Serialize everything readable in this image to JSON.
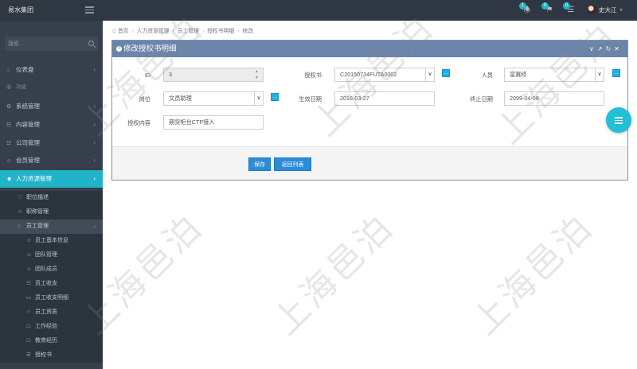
{
  "app": {
    "brand": "易水集团"
  },
  "topbar": {
    "badges": [
      "1",
      "0",
      "0"
    ],
    "user_name": "史大江"
  },
  "sidebar": {
    "search_placeholder": "搜索...",
    "items": [
      {
        "label": "仪表盘"
      },
      {
        "label": "功能"
      },
      {
        "label": "系统管理"
      },
      {
        "label": "内容管理"
      },
      {
        "label": "公司管理"
      },
      {
        "label": "会员管理"
      },
      {
        "label": "人力资源管理"
      }
    ],
    "sub_items": [
      {
        "label": "职位描述"
      },
      {
        "label": "职称管理"
      },
      {
        "label": "员工管理"
      }
    ],
    "sub2_items": [
      {
        "label": "员工基本信息"
      },
      {
        "label": "团队管理"
      },
      {
        "label": "团队成员"
      },
      {
        "label": "员工收支"
      },
      {
        "label": "员工收支明细"
      },
      {
        "label": "员工资质"
      },
      {
        "label": "工作经验"
      },
      {
        "label": "教育经历"
      },
      {
        "label": "授权书"
      }
    ]
  },
  "breadcrumb": [
    "首页",
    "人力资源管理",
    "员工管理",
    "授权书明细",
    "修改"
  ],
  "panel": {
    "title": "修改授权书明细"
  },
  "form": {
    "id_label": "ID",
    "id_value": "3",
    "auth_label": "授权书",
    "auth_value": "C20150734FUTA0002",
    "person_label": "人员",
    "person_value": "富赛修",
    "post_label": "岗位",
    "post_value": "文员助理",
    "start_label": "生效日期",
    "start_value": "2018-03-27",
    "end_label": "终止日期",
    "end_value": "2099-04-08",
    "content_label": "授权内容",
    "content_value": "期货柜台CTP接入"
  },
  "buttons": {
    "save": "保存",
    "back": "返回列表"
  },
  "watermark": "上海邑泊",
  "colors": {
    "accent": "#21b3c7",
    "panel_header": "#6b85aa",
    "button": "#2c8cd8"
  }
}
